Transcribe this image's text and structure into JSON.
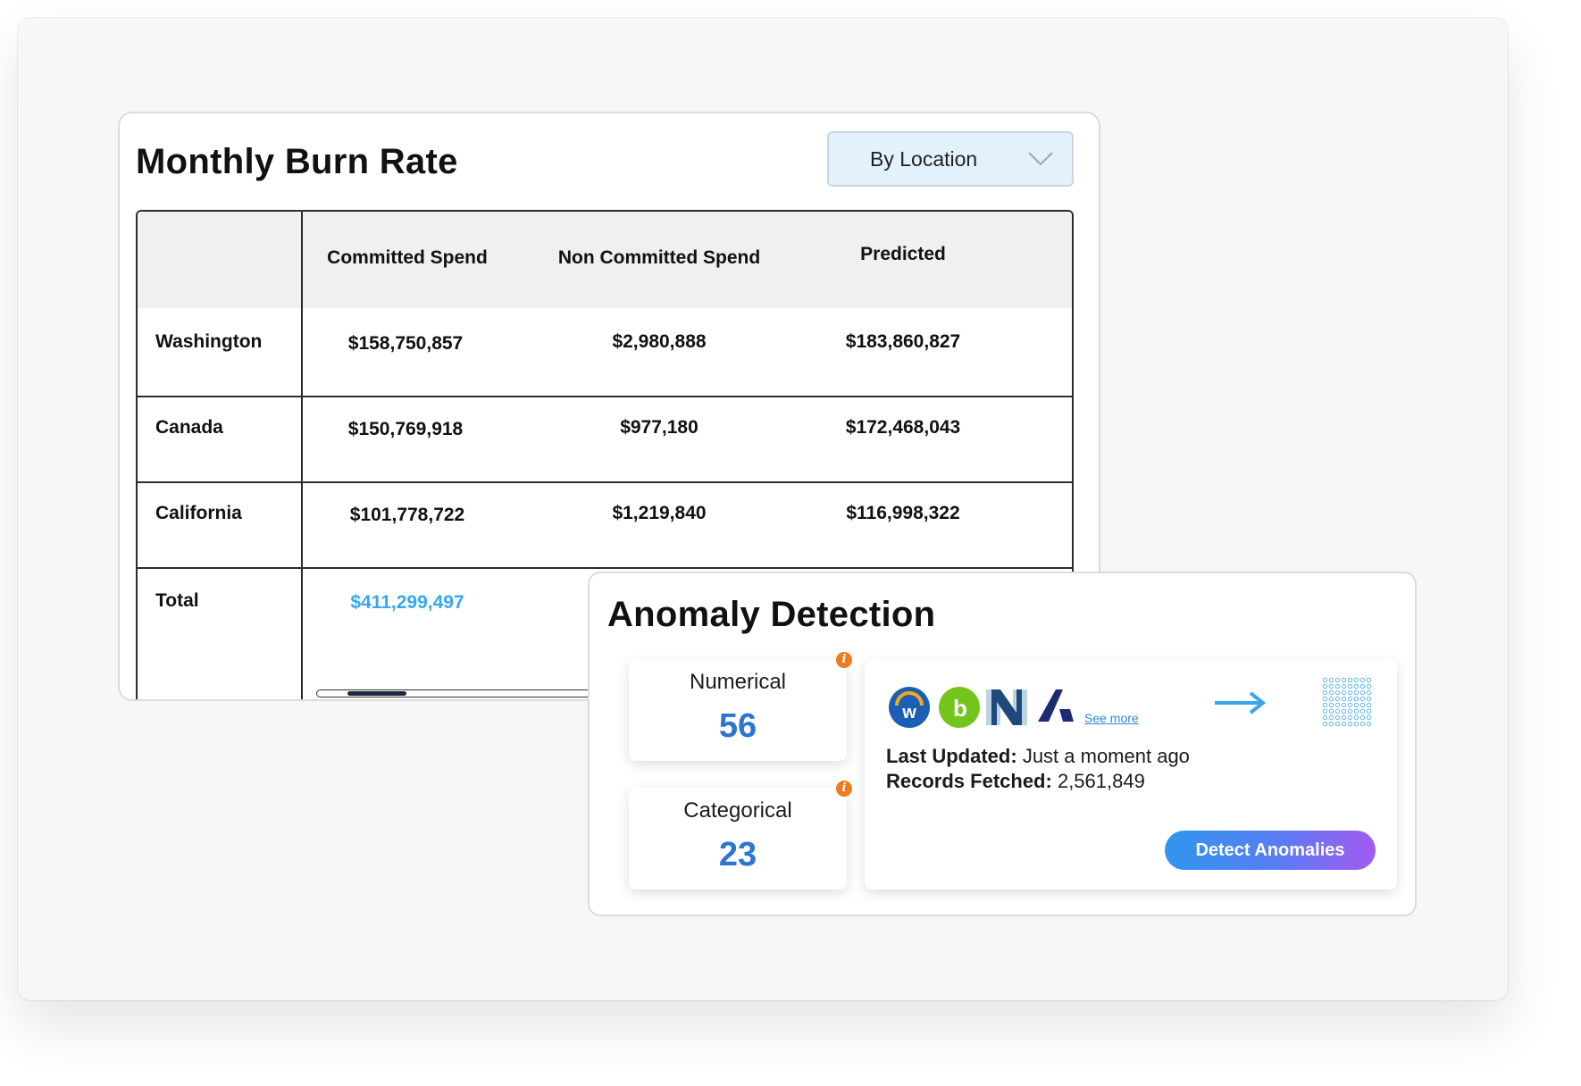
{
  "burn_rate": {
    "title": "Monthly Burn Rate",
    "dropdown": {
      "selected": "By Location"
    },
    "columns": [
      "",
      "Committed Spend",
      "Non Committed Spend",
      "Predicted"
    ],
    "rows": [
      {
        "label": "Washington",
        "committed": "$158,750,857",
        "non_committed": "$2,980,888",
        "predicted": "$183,860,827"
      },
      {
        "label": "Canada",
        "committed": "$150,769,918",
        "non_committed": "$977,180",
        "predicted": "$172,468,043"
      },
      {
        "label": "California",
        "committed": "$101,778,722",
        "non_committed": "$1,219,840",
        "predicted": "$116,998,322"
      }
    ],
    "total": {
      "label": "Total",
      "committed": "$411,299,497"
    }
  },
  "anomaly": {
    "title": "Anomaly Detection",
    "stats": [
      {
        "label": "Numerical",
        "value": "56"
      },
      {
        "label": "Categorical",
        "value": "23"
      }
    ],
    "info_icon": "i",
    "see_more": "See more",
    "last_updated_label": "Last Updated:",
    "last_updated_value": "Just a moment ago",
    "records_label": "Records Fetched:",
    "records_value": "2,561,849",
    "detect_button": "Detect Anomalies",
    "logo_letters": [
      "w",
      "b",
      "N",
      "A"
    ]
  },
  "colors": {
    "accent_blue": "#2e74d3",
    "total_blue": "#36a8f0",
    "info_orange": "#f07a20",
    "dropdown_bg": "#e3f1fc"
  }
}
